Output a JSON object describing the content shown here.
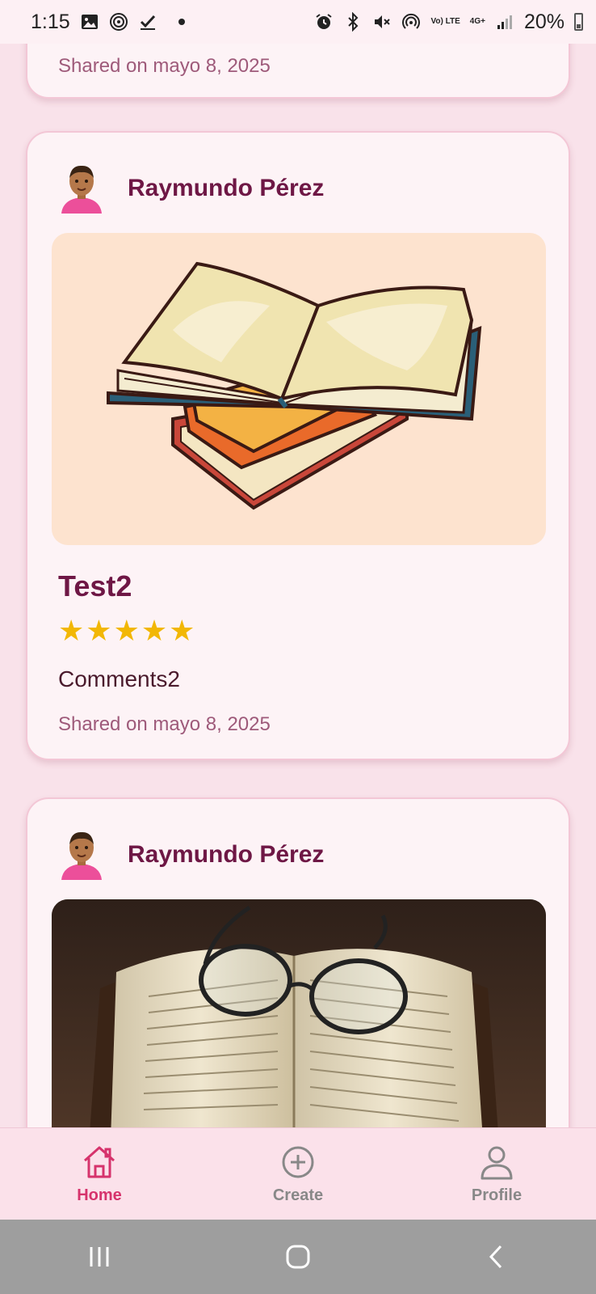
{
  "status_bar": {
    "time": "1:15",
    "battery": "20%",
    "network_top": "Vo) LTE",
    "network_type": "4G+"
  },
  "posts": [
    {
      "shared": "Shared on mayo 8, 2025"
    },
    {
      "author": "Raymundo Pérez",
      "image": "open-book-illustration",
      "title": "Test2",
      "rating": 5,
      "comment": "Comments2",
      "shared": "Shared on mayo 8, 2025"
    },
    {
      "author": "Raymundo Pérez",
      "image": "book-with-glasses-photo"
    }
  ],
  "nav": {
    "items": [
      {
        "label": "Home",
        "icon": "home-icon",
        "active": true
      },
      {
        "label": "Create",
        "icon": "add-circle-icon",
        "active": false
      },
      {
        "label": "Profile",
        "icon": "person-icon",
        "active": false
      }
    ]
  },
  "colors": {
    "accent": "#d6336c",
    "title": "#6e1745",
    "star": "#f2b705",
    "background": "#f9e2ea"
  }
}
